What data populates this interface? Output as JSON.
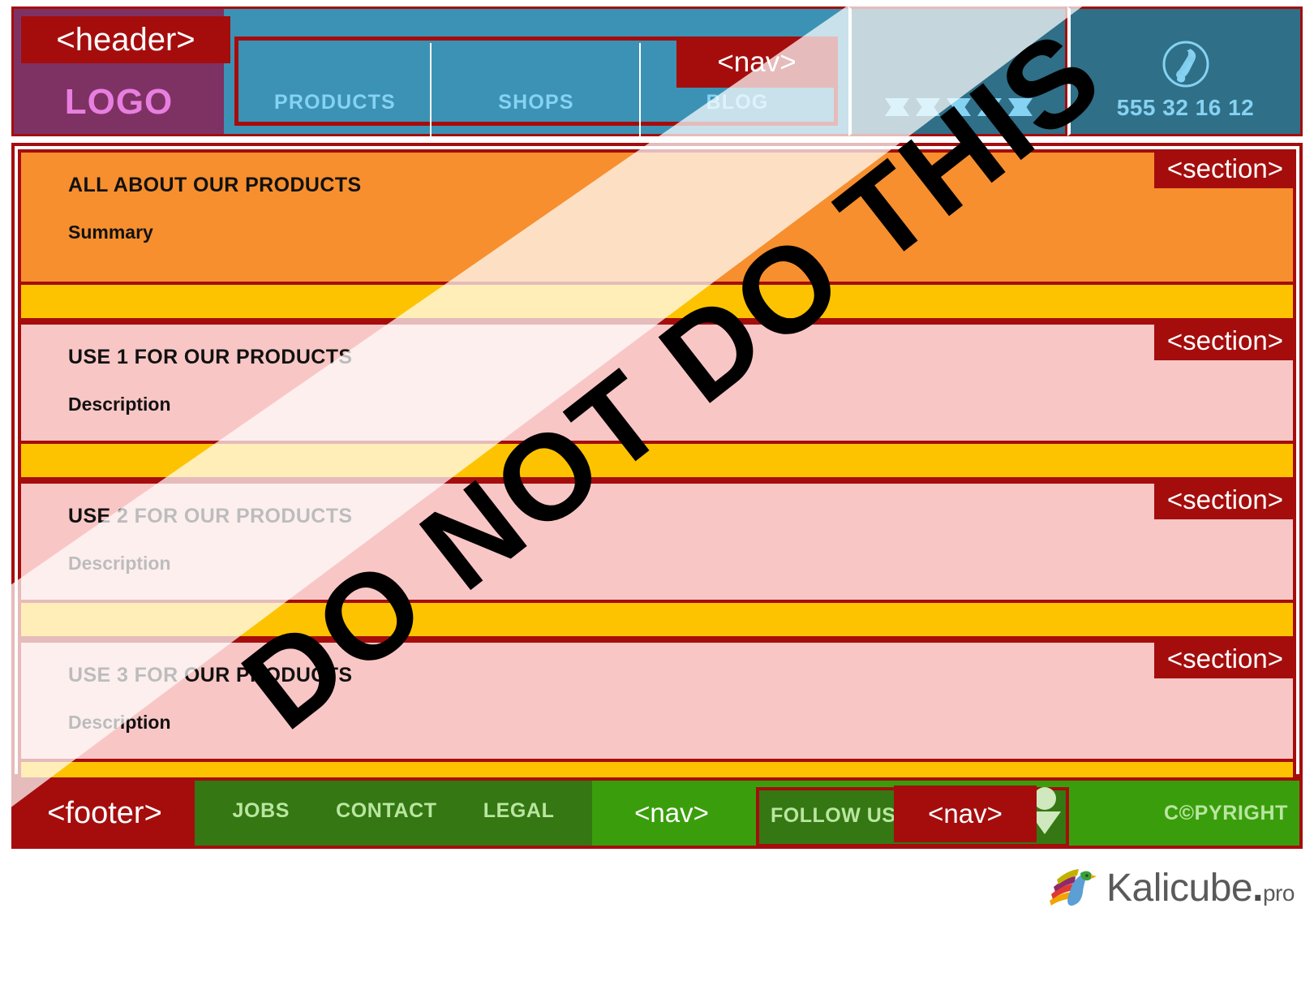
{
  "header": {
    "tag_label": "<header>",
    "logo": "LOGO",
    "nav_tag_label": "<nav>",
    "nav_items": [
      {
        "label": "PRODUCTS"
      },
      {
        "label": "SHOPS"
      },
      {
        "label": "BLOG"
      }
    ],
    "rating": {
      "icon": "star-icon",
      "count": 5
    },
    "phone": {
      "icon": "phone-icon",
      "number": "555 32 16 12"
    }
  },
  "main": {
    "sections": [
      {
        "tag_label": "<section>",
        "title": "ALL ABOUT OUR PRODUCTS",
        "subtitle": "Summary",
        "color": "#f78f2e"
      },
      {
        "tag_label": "<section>",
        "title": "USE 1 FOR OUR PRODUCTS",
        "subtitle": "Description",
        "color": "#f9c6c6"
      },
      {
        "tag_label": "<section>",
        "title": "USE 2 FOR OUR PRODUCTS",
        "subtitle": "Description",
        "color": "#f9c6c6"
      },
      {
        "tag_label": "<section>",
        "title": "USE 3 FOR OUR PRODUCTS",
        "subtitle": "Description",
        "color": "#f9c6c6"
      }
    ]
  },
  "footer": {
    "tag_label": "<footer>",
    "links": [
      {
        "label": "JOBS"
      },
      {
        "label": "CONTACT"
      },
      {
        "label": "LEGAL"
      }
    ],
    "nav_tag_label": "<nav>",
    "follow_label": "FOLLOW US:",
    "social_nav_tag_label": "<nav>",
    "social_icons": [
      "social-icon",
      "social-icon",
      "social-icon"
    ],
    "copyright": "C©PYRIGHT"
  },
  "watermark": {
    "text": "DO NOT DO THIS"
  },
  "brand": {
    "icon": "kalicube-bird-logo",
    "name": "Kalicube",
    "dot": ".",
    "suffix": "pro"
  },
  "colors": {
    "tag_red": "#a50d0d",
    "logo_purple": "#7e3264",
    "nav_blue": "#3b92b5",
    "panel_blue": "#2f6f87",
    "accent_light_blue": "#86d2f2",
    "section_orange": "#f78f2e",
    "section_pink": "#f9c6c6",
    "divider_yellow": "#fdc300",
    "footer_green": "#3a9e0c",
    "footer_nav_green": "#357712",
    "footer_text_green": "#b9e6a0"
  }
}
